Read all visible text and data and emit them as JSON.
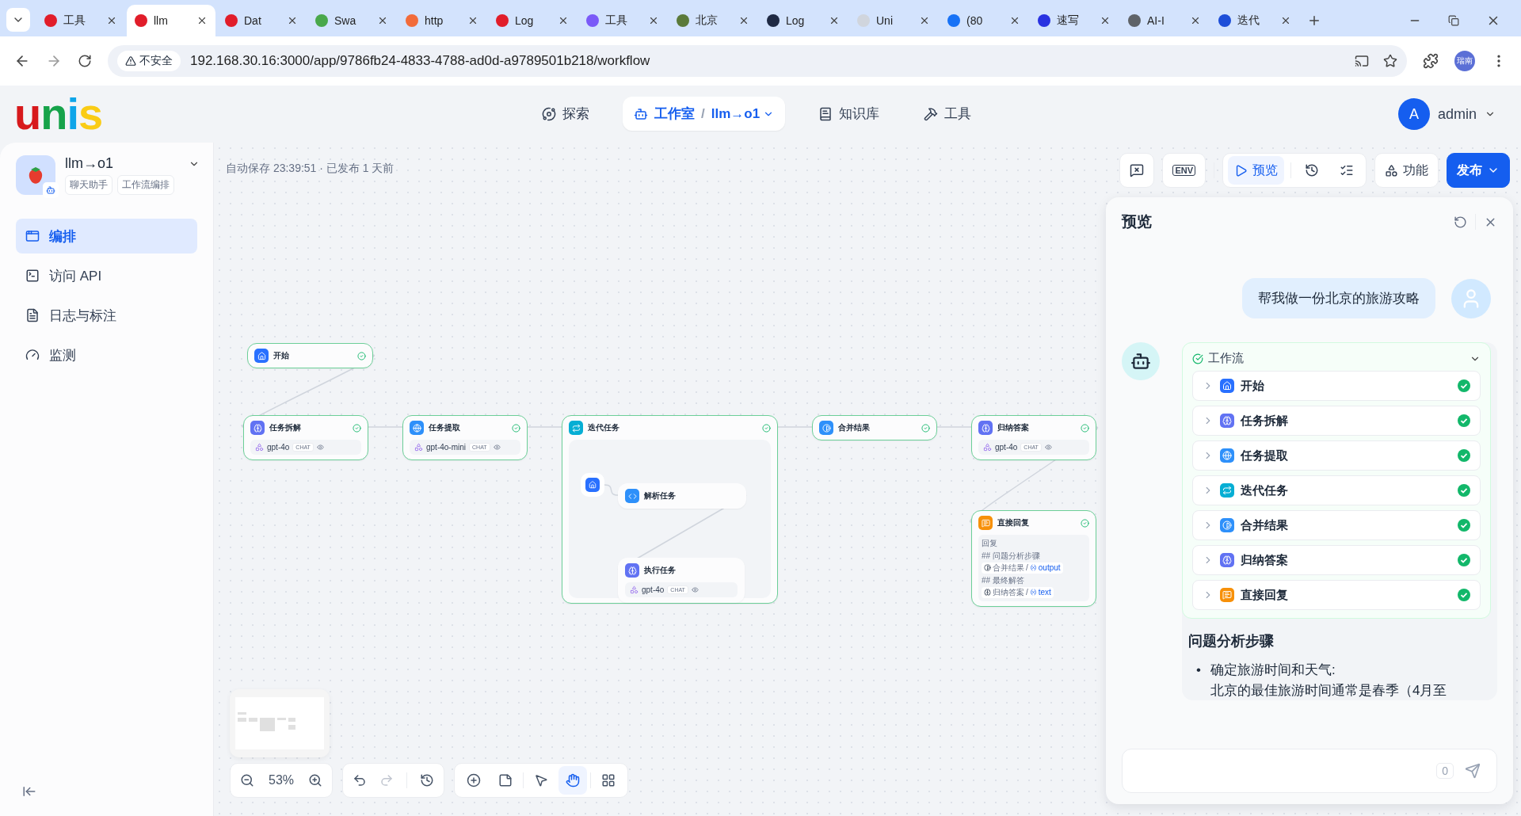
{
  "browser": {
    "tabs": [
      {
        "title": "工具",
        "selected": false,
        "color": "#e11d2a"
      },
      {
        "title": "llm",
        "selected": true,
        "color": "#e11d2a"
      },
      {
        "title": "Dat",
        "selected": false,
        "color": "#e11d2a"
      },
      {
        "title": "Swa",
        "selected": false,
        "color": "#49a84b"
      },
      {
        "title": "http",
        "selected": false,
        "color": "#f26b3a"
      },
      {
        "title": "Log",
        "selected": false,
        "color": "#e11d2a"
      },
      {
        "title": "工具",
        "selected": false,
        "color": "#7a5af8"
      },
      {
        "title": "北京",
        "selected": false,
        "color": "#5b7a3a"
      },
      {
        "title": "Log",
        "selected": false,
        "color": "#1f2a44"
      },
      {
        "title": "Uni",
        "selected": false,
        "color": "#d0d5dd"
      },
      {
        "title": "(80",
        "selected": false,
        "color": "#1772f6"
      },
      {
        "title": "速写",
        "selected": false,
        "color": "#2932e1"
      },
      {
        "title": "AI-I",
        "selected": false,
        "color": "#5f6368"
      },
      {
        "title": "迭代",
        "selected": false,
        "color": "#1d4ed8"
      }
    ],
    "security": "不安全",
    "url": "192.168.30.16:3000/app/9786fb24-4833-4788-ad0d-a9789501b218/workflow",
    "profile": "瑞南"
  },
  "header": {
    "logo": "unis",
    "nav": [
      {
        "label": "探索",
        "kind": "explore",
        "selected": false
      },
      {
        "label": "工作室",
        "kind": "studio",
        "selected": true
      },
      {
        "label": "知识库",
        "kind": "knowledge",
        "selected": false
      },
      {
        "label": "工具",
        "kind": "tools",
        "selected": false
      }
    ],
    "separator": "/",
    "app_switch": "llm→o1",
    "user": {
      "initial": "A",
      "name": "admin"
    }
  },
  "sidebar": {
    "app_name": "llm→o1",
    "tags": [
      "聊天助手",
      "工作流编排"
    ],
    "items": [
      {
        "label": "编排",
        "kind": "orchestrate",
        "selected": true
      },
      {
        "label": "访问 API",
        "kind": "api",
        "selected": false
      },
      {
        "label": "日志与标注",
        "kind": "logs",
        "selected": false
      },
      {
        "label": "监测",
        "kind": "monitor",
        "selected": false
      }
    ]
  },
  "toolbar": {
    "status": "自动保存 23:39:51 · 已发布 1 天前",
    "env": "ENV",
    "preview": {
      "label": "预览",
      "selected": true
    },
    "features": "功能",
    "publish": "发布"
  },
  "nodes": [
    {
      "title": "开始",
      "kind": "start",
      "done": true
    },
    {
      "title": "任务拆解",
      "kind": "llm",
      "done": true,
      "model": "gpt-4o",
      "mode": "CHAT"
    },
    {
      "title": "任务提取",
      "kind": "extractor",
      "done": true,
      "model": "gpt-4o-mini",
      "mode": "CHAT"
    },
    {
      "title": "迭代任务",
      "kind": "iteration",
      "done": true,
      "children": [
        {
          "kind": "start"
        },
        {
          "title": "解析任务",
          "kind": "code"
        },
        {
          "title": "执行任务",
          "kind": "llm",
          "model": "gpt-4o",
          "mode": "CHAT"
        }
      ]
    },
    {
      "title": "合并结果",
      "kind": "merge",
      "done": true
    },
    {
      "title": "归纳答案",
      "kind": "llm",
      "done": true,
      "model": "gpt-4o",
      "mode": "CHAT"
    },
    {
      "title": "直接回复",
      "kind": "answer",
      "done": true,
      "content": [
        {
          "kind": "text",
          "text": "回复"
        },
        {
          "kind": "text",
          "text": "## 问题分析步骤"
        },
        {
          "kind": "var",
          "source": {
            "title": "合并结果",
            "kind": "merge"
          },
          "sep": "/",
          "var": "output"
        },
        {
          "kind": "text",
          "text": "## 最终解答"
        },
        {
          "kind": "var",
          "source": {
            "title": "归纳答案",
            "kind": "llm"
          },
          "sep": "/",
          "var": "text"
        }
      ]
    }
  ],
  "canvas_controls": {
    "zoom": "53%",
    "tools": [
      {
        "kind": "add",
        "selected": false
      },
      {
        "kind": "note",
        "selected": false
      },
      {
        "kind": "pointer",
        "selected": false
      },
      {
        "kind": "hand",
        "selected": true
      },
      {
        "kind": "layout",
        "selected": false
      }
    ]
  },
  "preview": {
    "title": "预览",
    "user_message": "帮我做一份北京的旅游攻略",
    "workflow": {
      "label": "工作流",
      "expanded": true,
      "steps": [
        {
          "name": "开始",
          "kind": "start",
          "done": true
        },
        {
          "name": "任务拆解",
          "kind": "llm",
          "done": true
        },
        {
          "name": "任务提取",
          "kind": "extractor",
          "done": true
        },
        {
          "name": "迭代任务",
          "kind": "iteration",
          "done": true
        },
        {
          "name": "合并结果",
          "kind": "merge",
          "done": true
        },
        {
          "name": "归纳答案",
          "kind": "llm",
          "done": true
        },
        {
          "name": "直接回复",
          "kind": "answer",
          "done": true
        }
      ]
    },
    "answer": {
      "heading": "问题分析步骤",
      "bullets": [
        {
          "marker": "•",
          "title": "确定旅游时间和天气:",
          "text": "北京的最佳旅游时间通常是春季（4月至"
        }
      ]
    },
    "input": {
      "count": "0"
    }
  }
}
